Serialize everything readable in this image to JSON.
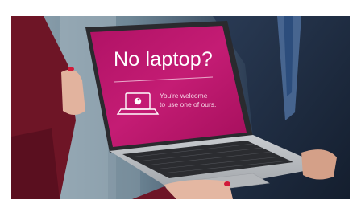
{
  "screen": {
    "headline": "No laptop?",
    "subline_1": "You're welcome",
    "subline_2": "to use one of ours."
  },
  "colors": {
    "screen_magenta": "#c01871",
    "laptop_silver": "#b9bcc0",
    "sleeve_burgundy": "#6e1526",
    "suit_navy": "#1f2e44",
    "nail_polish": "#d11a3a"
  },
  "icons": [
    "laptop-logo-icon"
  ]
}
